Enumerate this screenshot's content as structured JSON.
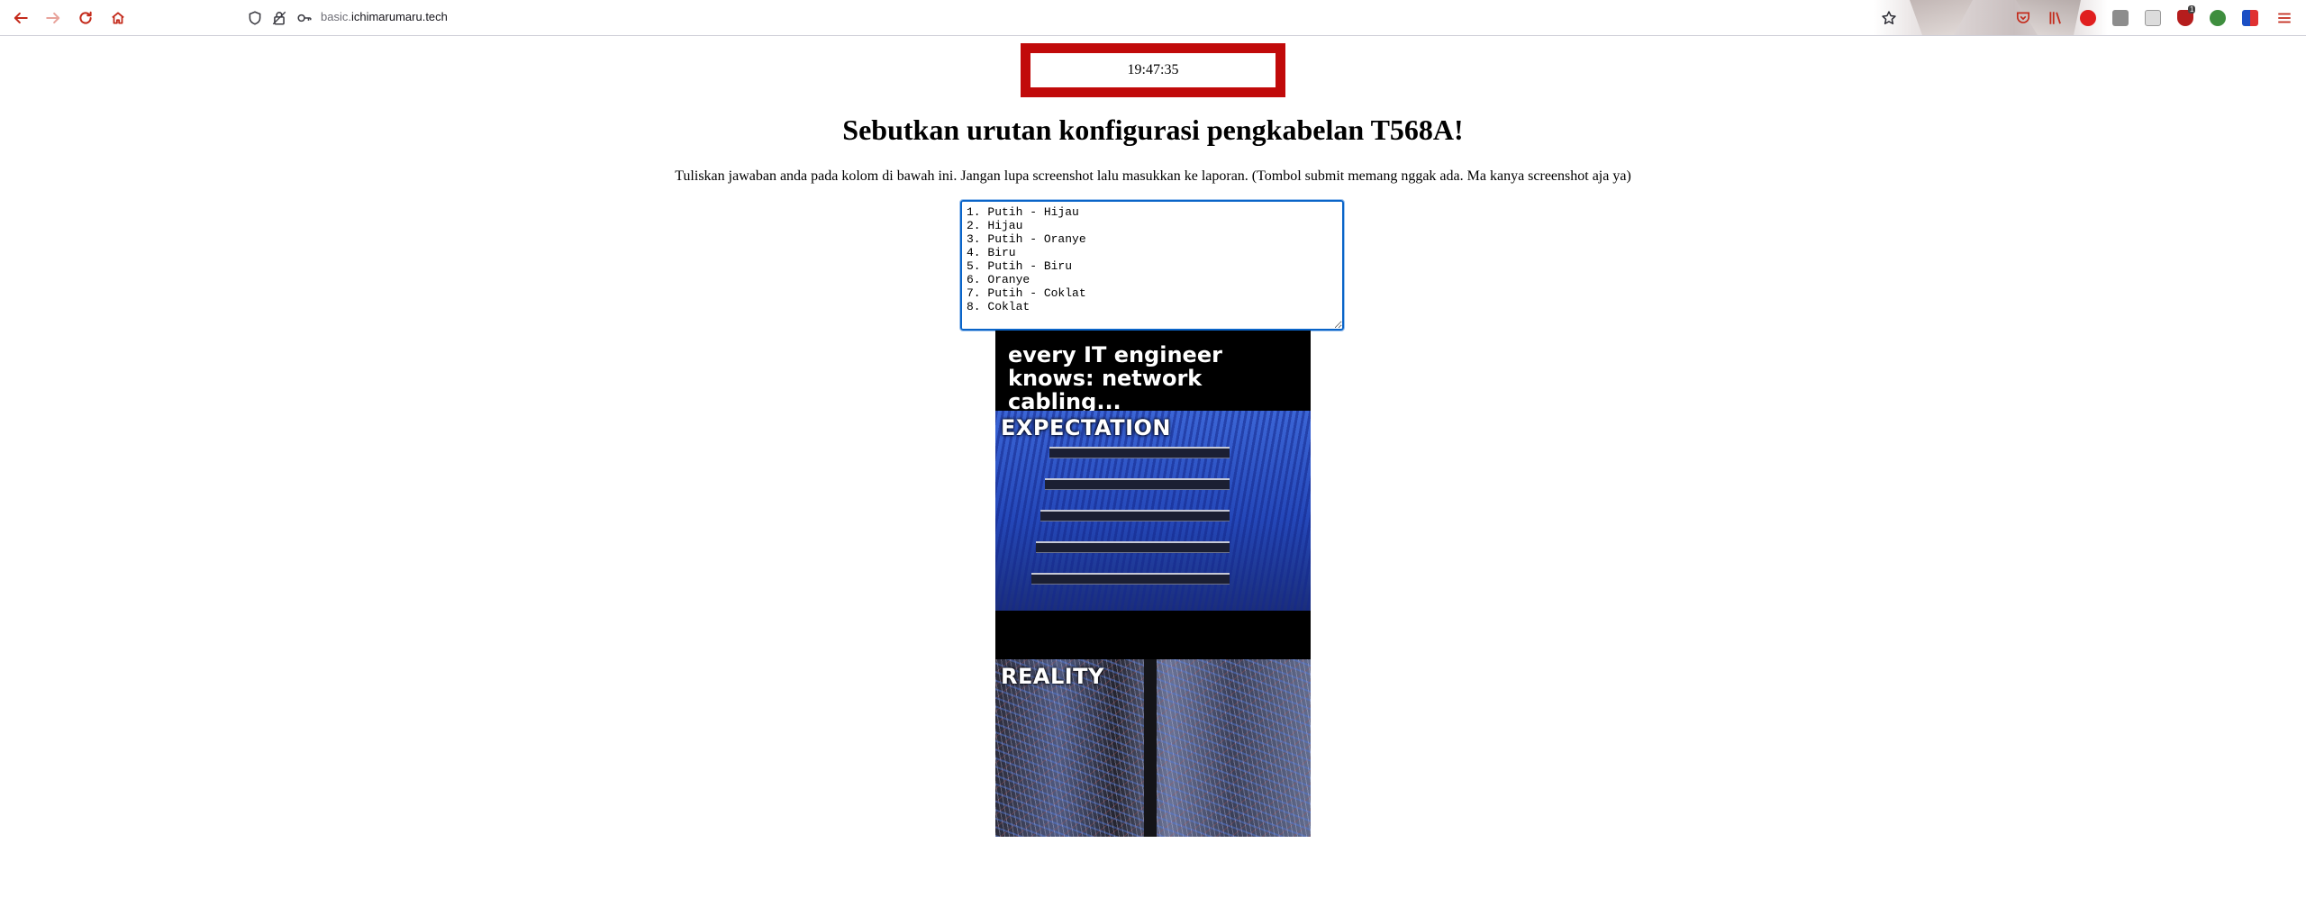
{
  "browser": {
    "url_prefix": "basic.",
    "url_domain": "ichimarumaru.tech",
    "extension_badge": "1"
  },
  "page": {
    "clock": "19:47:35",
    "clock_border_color": "#c10a0a",
    "title": "Sebutkan urutan konfigurasi pengkabelan T568A!",
    "instruction": "Tuliskan jawaban anda pada kolom di bawah ini. Jangan lupa screenshot lalu masukkan ke laporan. (Tombol submit memang nggak ada. Ma kanya screenshot aja ya)",
    "answer": "1. Putih - Hijau\n2. Hijau\n3. Putih - Oranye\n4. Biru\n5. Putih - Biru\n6. Oranye\n7. Putih - Coklat\n8. Coklat"
  },
  "meme": {
    "caption": "every IT engineer knows: network cabling...",
    "label_expectation": "EXPECTATION",
    "label_reality": "REALITY"
  },
  "icons": [
    "back-arrow-icon",
    "forward-arrow-icon",
    "reload-icon",
    "home-icon",
    "shield-icon",
    "lock-icon",
    "key-icon",
    "bookmark-star-icon",
    "pocket-icon",
    "library-icon",
    "menu-icon"
  ]
}
